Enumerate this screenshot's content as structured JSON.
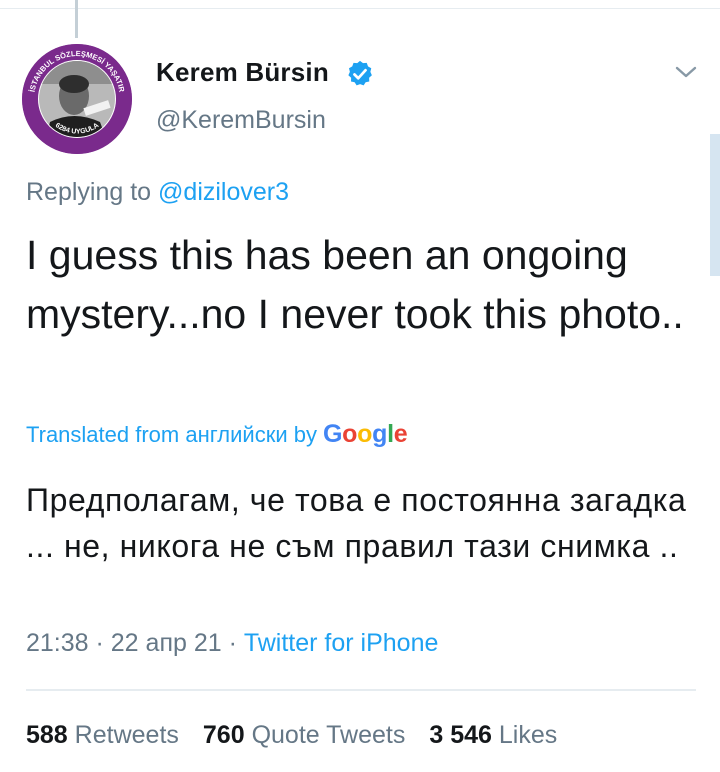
{
  "author": {
    "name": "Kerem Bürsin",
    "handle": "@KeremBursin",
    "avatar_ring_text_top": "İSTANBUL SÖZLEŞMESİ YAŞATIR",
    "avatar_ring_text_bottom": "6284 UYGULA"
  },
  "reply": {
    "prefix": "Replying to ",
    "mention": "@dizilover3"
  },
  "tweet": {
    "text": "I guess this has been an ongoing mystery...no I never took this photo.."
  },
  "translation": {
    "label": "Translated from английски by",
    "provider": "Google",
    "text": "Предполагам, че това е постоянна загадка ... не, никога не съм правил тази снимка .."
  },
  "meta": {
    "time": "21:38",
    "separator": " · ",
    "date": "22 апр 21",
    "source": "Twitter for iPhone"
  },
  "stats": {
    "retweets_count": "588",
    "retweets_label": "Retweets",
    "quotes_count": "760",
    "quotes_label": "Quote Tweets",
    "likes_count": "3 546",
    "likes_label": "Likes"
  },
  "colors": {
    "link": "#1da1f2",
    "secondary_text": "#657786",
    "primary_text": "#14171a",
    "avatar_ring": "#7a2a8c"
  },
  "icons": {
    "verified": "verified-badge-icon",
    "more": "chevron-down-icon"
  }
}
